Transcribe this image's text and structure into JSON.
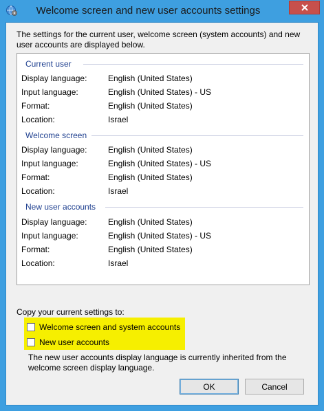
{
  "window": {
    "title": "Welcome screen and new user accounts settings",
    "icons": {
      "app": "globe-settings-icon",
      "close": "close-icon"
    }
  },
  "intro": "The settings for the current user, welcome screen (system accounts) and new user accounts are displayed below.",
  "groups": [
    {
      "header": "Current user",
      "rows": [
        {
          "label": "Display language:",
          "value": "English (United States)"
        },
        {
          "label": "Input language:",
          "value": "English (United States) - US"
        },
        {
          "label": "Format:",
          "value": "English (United States)"
        },
        {
          "label": "Location:",
          "value": "Israel"
        }
      ]
    },
    {
      "header": "Welcome screen",
      "rows": [
        {
          "label": "Display language:",
          "value": "English (United States)"
        },
        {
          "label": "Input language:",
          "value": "English (United States) - US"
        },
        {
          "label": "Format:",
          "value": "English (United States)"
        },
        {
          "label": "Location:",
          "value": "Israel"
        }
      ]
    },
    {
      "header": "New user accounts",
      "rows": [
        {
          "label": "Display language:",
          "value": "English (United States)"
        },
        {
          "label": "Input language:",
          "value": "English (United States) - US"
        },
        {
          "label": "Format:",
          "value": "English (United States)"
        },
        {
          "label": "Location:",
          "value": "Israel"
        }
      ]
    }
  ],
  "copy": {
    "label": "Copy your current settings to:",
    "checkboxes": [
      {
        "label": "Welcome screen and system accounts",
        "checked": false
      },
      {
        "label": "New user accounts",
        "checked": false
      }
    ],
    "highlight_color": "#f6ef00"
  },
  "note": "The new user accounts display language is currently inherited from the welcome screen display language.",
  "buttons": {
    "ok": "OK",
    "cancel": "Cancel"
  }
}
